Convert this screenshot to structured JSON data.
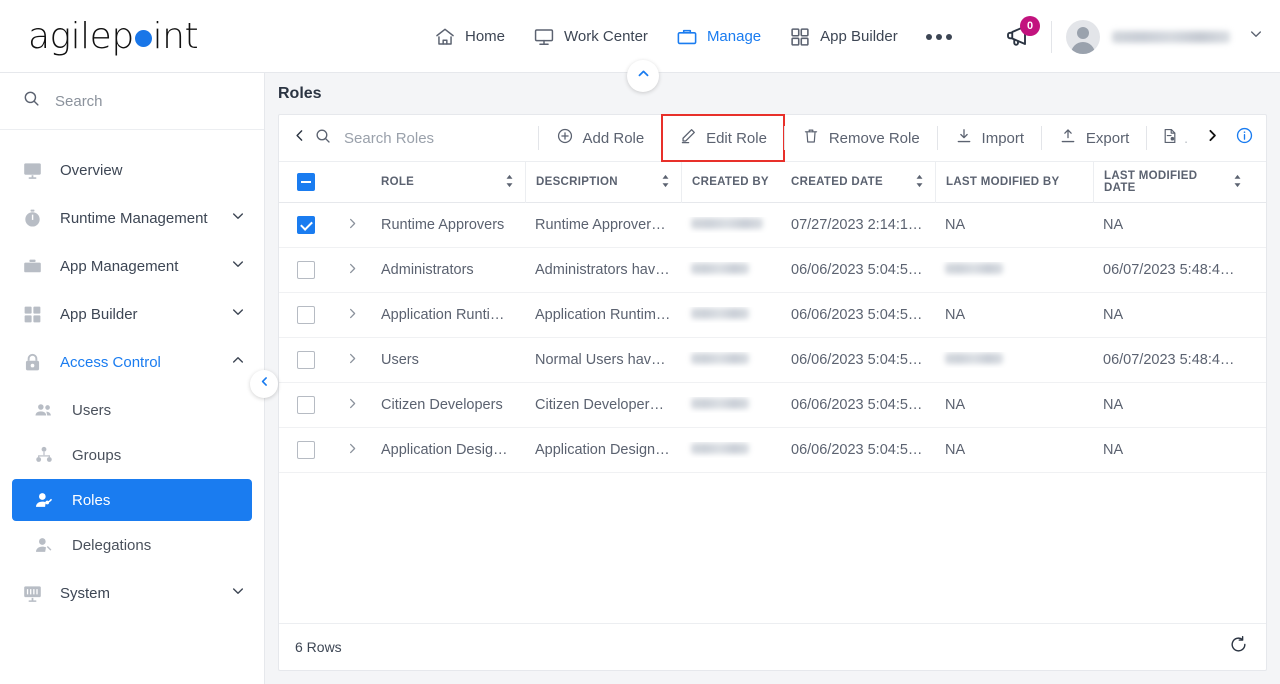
{
  "brand": {
    "name_part1": "agilep",
    "name_part2": "int",
    "dot_color": "#1976e8"
  },
  "header": {
    "nav": [
      {
        "label": "Home",
        "icon": "home-icon",
        "active": false
      },
      {
        "label": "Work Center",
        "icon": "monitor-icon",
        "active": false
      },
      {
        "label": "Manage",
        "icon": "briefcase-icon",
        "active": true
      },
      {
        "label": "App Builder",
        "icon": "grid-icon",
        "active": false
      }
    ],
    "overflow_icon": "ellipsis-icon",
    "notification": {
      "icon": "megaphone-icon",
      "badge_count": "0",
      "badge_color": "#c2137e"
    },
    "account": {
      "avatar_icon": "avatar-icon",
      "username": "",
      "caret_icon": "chevron-down-icon"
    },
    "collapse_toggle_icon": "chevron-up-icon"
  },
  "sidebar": {
    "search": {
      "placeholder": "Search",
      "icon": "search-icon"
    },
    "items": [
      {
        "label": "Overview",
        "icon": "overview-icon",
        "expandable": false,
        "accent": false
      },
      {
        "label": "Runtime Management",
        "icon": "clock-icon",
        "expandable": true,
        "accent": false,
        "chevron": "chevron-down-icon"
      },
      {
        "label": "App Management",
        "icon": "briefcase-icon",
        "expandable": true,
        "accent": false,
        "chevron": "chevron-down-icon"
      },
      {
        "label": "App Builder",
        "icon": "grid-icon",
        "expandable": true,
        "accent": false,
        "chevron": "chevron-down-icon"
      },
      {
        "label": "Access Control",
        "icon": "lock-icon",
        "expandable": true,
        "accent": true,
        "chevron": "chevron-up-icon"
      }
    ],
    "sub_items": [
      {
        "label": "Users",
        "icon": "users-icon",
        "selected": false
      },
      {
        "label": "Groups",
        "icon": "groups-icon",
        "selected": false
      },
      {
        "label": "Roles",
        "icon": "role-icon",
        "selected": true
      },
      {
        "label": "Delegations",
        "icon": "delegation-icon",
        "selected": false
      }
    ],
    "items_after": [
      {
        "label": "System",
        "icon": "system-icon",
        "expandable": true,
        "chevron": "chevron-down-icon"
      }
    ],
    "collapse_icon": "chevron-left-icon",
    "selected_color": "#1a7cf0"
  },
  "main": {
    "page_title": "Roles",
    "toolbar": {
      "back_icon": "chevron-left-icon",
      "search": {
        "placeholder": "Search Roles",
        "icon": "search-icon"
      },
      "buttons": [
        {
          "label": "Add Role",
          "icon": "plus-circle-icon",
          "highlighted": false
        },
        {
          "label": "Edit Role",
          "icon": "pencil-icon",
          "highlighted": true
        },
        {
          "label": "Remove Role",
          "icon": "trash-icon",
          "highlighted": false
        },
        {
          "label": "Import",
          "icon": "import-icon",
          "highlighted": false
        },
        {
          "label": "Export",
          "icon": "export-icon",
          "highlighted": false
        }
      ],
      "report_button": {
        "icon": "report-icon",
        "label": "."
      },
      "more_icon": "chevron-right-icon",
      "info_icon": "info-icon",
      "highlight_color": "#e8302a"
    },
    "table": {
      "select_all_state": "indeterminate",
      "columns": [
        {
          "label": "ROLE",
          "sortable": true
        },
        {
          "label": "DESCRIPTION",
          "sortable": true
        },
        {
          "label": "CREATED BY",
          "sortable": false
        },
        {
          "label": "CREATED DATE",
          "sortable": true
        },
        {
          "label": "LAST MODIFIED BY",
          "sortable": false
        },
        {
          "label": "LAST MODIFIED DATE",
          "sortable": true
        }
      ],
      "rows": [
        {
          "selected": true,
          "role": "Runtime Approvers",
          "description": "Runtime Approvers…",
          "created_by": "",
          "created_by_redacted": true,
          "created_by_width": 72,
          "created_date": "07/27/2023 2:14:1…",
          "last_modified_by": "NA",
          "last_modified_by_redacted": false,
          "last_modified_by_width": 0,
          "last_modified_date": "NA"
        },
        {
          "selected": false,
          "role": "Administrators",
          "description": "Administrators hav…",
          "created_by": "",
          "created_by_redacted": true,
          "created_by_width": 58,
          "created_date": "06/06/2023 5:04:5…",
          "last_modified_by": "",
          "last_modified_by_redacted": true,
          "last_modified_by_width": 58,
          "last_modified_date": "06/07/2023 5:48:4…"
        },
        {
          "selected": false,
          "role": "Application Runtim…",
          "description": "Application Runtim…",
          "created_by": "",
          "created_by_redacted": true,
          "created_by_width": 58,
          "created_date": "06/06/2023 5:04:5…",
          "last_modified_by": "NA",
          "last_modified_by_redacted": false,
          "last_modified_by_width": 0,
          "last_modified_date": "NA"
        },
        {
          "selected": false,
          "role": "Users",
          "description": "Normal Users have…",
          "created_by": "",
          "created_by_redacted": true,
          "created_by_width": 58,
          "created_date": "06/06/2023 5:04:5…",
          "last_modified_by": "",
          "last_modified_by_redacted": true,
          "last_modified_by_width": 58,
          "last_modified_date": "06/07/2023 5:48:4…"
        },
        {
          "selected": false,
          "role": "Citizen Developers",
          "description": "Citizen Developers …",
          "created_by": "",
          "created_by_redacted": true,
          "created_by_width": 58,
          "created_date": "06/06/2023 5:04:5…",
          "last_modified_by": "NA",
          "last_modified_by_redacted": false,
          "last_modified_by_width": 0,
          "last_modified_date": "NA"
        },
        {
          "selected": false,
          "role": "Application Design…",
          "description": "Application Design…",
          "created_by": "",
          "created_by_redacted": true,
          "created_by_width": 58,
          "created_date": "06/06/2023 5:04:5…",
          "last_modified_by": "NA",
          "last_modified_by_redacted": false,
          "last_modified_by_width": 0,
          "last_modified_date": "NA"
        }
      ],
      "expand_icon": "chevron-right-icon",
      "sort_icon": "sort-icon"
    },
    "footer": {
      "row_count": "6 Rows",
      "refresh_icon": "refresh-icon"
    }
  }
}
